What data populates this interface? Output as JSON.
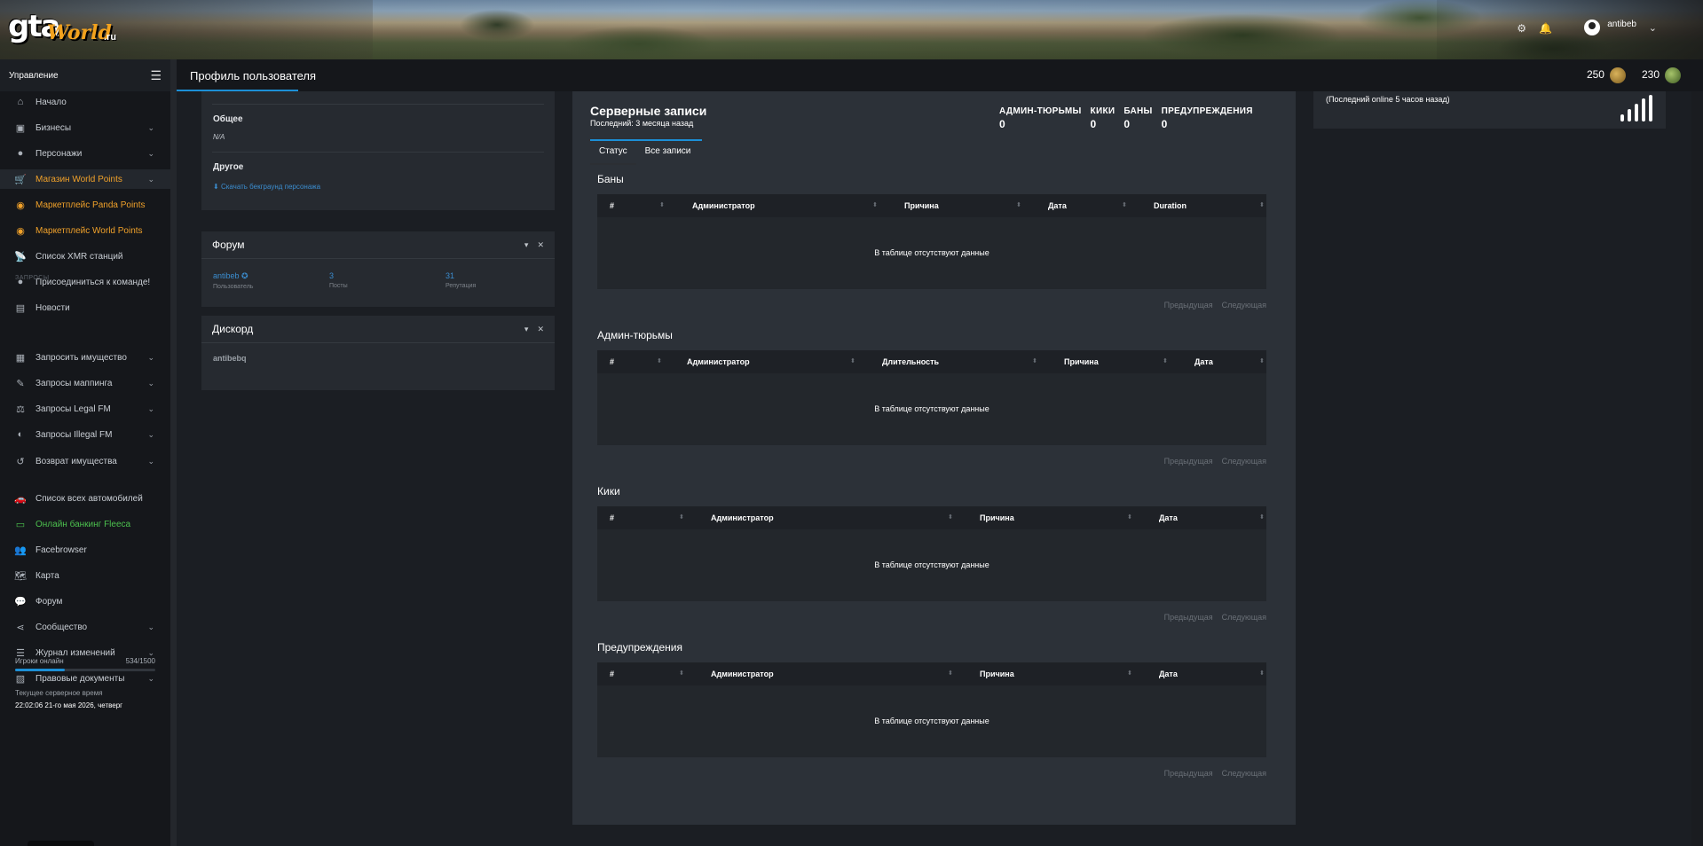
{
  "header": {
    "logo": {
      "main": "gta",
      "script": "World",
      "tld": ".ru"
    },
    "icons": [
      "gear-icon",
      "bell-icon"
    ],
    "user": {
      "name": "antibeb"
    }
  },
  "sidebar": {
    "title": "Управление",
    "items": [
      {
        "label": "Начало",
        "icon": "home-icon"
      },
      {
        "label": "Бизнесы",
        "icon": "briefcase-icon",
        "chevron": true
      },
      {
        "label": "Персонажи",
        "icon": "user-icon",
        "chevron": true
      },
      {
        "label": "Магазин World Points",
        "icon": "cart-icon",
        "chevron": true
      },
      {
        "label": "Маркетплейс Panda Points",
        "icon": "coins-icon"
      },
      {
        "label": "Маркетплейс World Points",
        "icon": "coins-icon"
      },
      {
        "label": "Список XMR станций",
        "icon": "antenna-icon"
      },
      {
        "label": "Присоединиться к команде!",
        "icon": "user-plus-icon"
      },
      {
        "label": "Новости",
        "icon": "newspaper-icon"
      },
      {
        "label": "Запросить имущество",
        "icon": "building-icon",
        "chevron": true
      },
      {
        "label": "Запросы маппинга",
        "icon": "brush-icon",
        "chevron": true
      },
      {
        "label": "Запросы Legal FM",
        "icon": "scale-icon",
        "chevron": true
      },
      {
        "label": "Запросы Illegal FM",
        "icon": "mask-icon",
        "chevron": true
      },
      {
        "label": "Возврат имущества",
        "icon": "undo-icon",
        "chevron": true
      },
      {
        "label": "Список всех автомобилей",
        "icon": "car-icon"
      },
      {
        "label": "Онлайн банкинг Fleeca",
        "icon": "bank-card-icon"
      },
      {
        "label": "Facebrowser",
        "icon": "users-icon"
      },
      {
        "label": "Карта",
        "icon": "map-icon"
      },
      {
        "label": "Форум",
        "icon": "comments-icon"
      },
      {
        "label": "Сообщество",
        "icon": "share-icon",
        "chevron": true
      },
      {
        "label": "Журнал изменений",
        "icon": "list-icon",
        "chevron": true
      },
      {
        "label": "Правовые документы",
        "icon": "docs-icon",
        "chevron": true
      }
    ],
    "section_label": "ЗАПРОСЫ",
    "players_label": "Игроки онлайн",
    "players_value": "534/1500",
    "players_fraction": 0.356,
    "time_label": "Текущее серверное время",
    "time_value": "22:02:06 21-го мая 2026, четверг"
  },
  "topbar": {
    "page_title": "Профиль пользователя",
    "coins": [
      {
        "value": "250",
        "icon": "world-points-coin-icon"
      },
      {
        "value": "230",
        "icon": "panda-points-coin-icon"
      }
    ]
  },
  "profile_card": {
    "general_label": "Общее",
    "general_value": "N/A",
    "other_label": "Другое",
    "download_link": "Скачать бекграунд персонажа"
  },
  "forum_card": {
    "title": "Форум",
    "user": "antibeb",
    "user_label": "Пользователь",
    "posts": "3",
    "posts_label": "Посты",
    "rep": "31",
    "rep_label": "Репутация"
  },
  "discord_card": {
    "title": "Дискорд",
    "user": "antibebq"
  },
  "server_records": {
    "title": "Серверные записи",
    "subtitle": "Последний: 3 месяца назад",
    "counts": [
      {
        "label": "АДМИН-ТЮРЬМЫ",
        "value": "0"
      },
      {
        "label": "КИКИ",
        "value": "0"
      },
      {
        "label": "БАНЫ",
        "value": "0"
      },
      {
        "label": "ПРЕДУПРЕЖДЕНИЯ",
        "value": "0"
      }
    ],
    "tabs": [
      "Статус",
      "Все записи"
    ],
    "empty_text": "В таблице отсутствуют данные",
    "prev": "Предыдущая",
    "next": "Следующая",
    "sections": [
      {
        "title": "Баны",
        "columns": [
          "#",
          "Администратор",
          "Причина",
          "Дата",
          "Duration"
        ]
      },
      {
        "title": "Админ-тюрьмы",
        "columns": [
          "#",
          "Администратор",
          "Длительность",
          "Причина",
          "Дата"
        ]
      },
      {
        "title": "Кики",
        "columns": [
          "#",
          "Администратор",
          "Причина",
          "Дата"
        ]
      },
      {
        "title": "Предупреждения",
        "columns": [
          "#",
          "Администратор",
          "Причина",
          "Дата"
        ]
      }
    ]
  },
  "status_panel": {
    "text": "(Последний online 5 часов назад)"
  },
  "colors": {
    "accent": "#1c8fd6",
    "orange": "#f0a12a",
    "green": "#4cc14e"
  }
}
